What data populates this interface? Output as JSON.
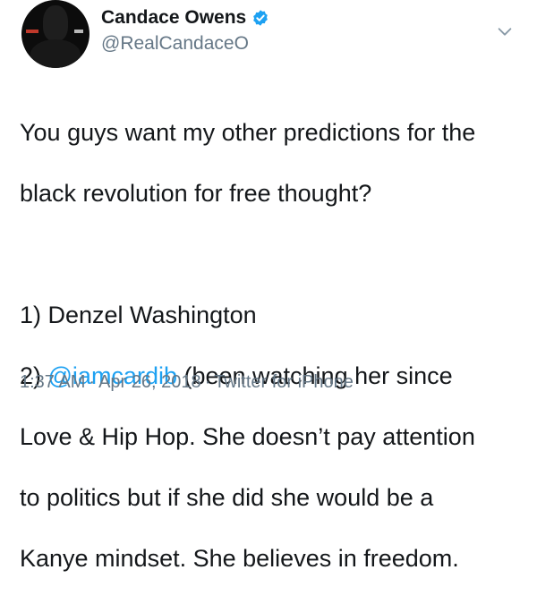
{
  "user": {
    "display_name": "Candace Owens",
    "handle": "@RealCandaceO",
    "verified": true
  },
  "icons": {
    "verified": "verified-badge-icon",
    "caret": "chevron-down-icon"
  },
  "tweet": {
    "line1": "You guys want my other predictions for the",
    "line2": "black revolution for free thought?",
    "item1": "1) Denzel Washington",
    "item2_prefix": "2) ",
    "item2_mention": "@iamcardib",
    "item2_rest": " (been watching her since",
    "line5": "Love & Hip Hop. She doesn’t pay attention",
    "line6": "to politics but if she did she would be a",
    "line7": "Kanye mindset. She believes in freedom."
  },
  "meta": {
    "time": "1:37 AM",
    "separator": "·",
    "date": "Apr 26, 2018",
    "source": "Twitter for iPhone"
  },
  "colors": {
    "mention": "#1da1f2",
    "secondary_text": "#657786",
    "verified": "#1da1f2"
  }
}
